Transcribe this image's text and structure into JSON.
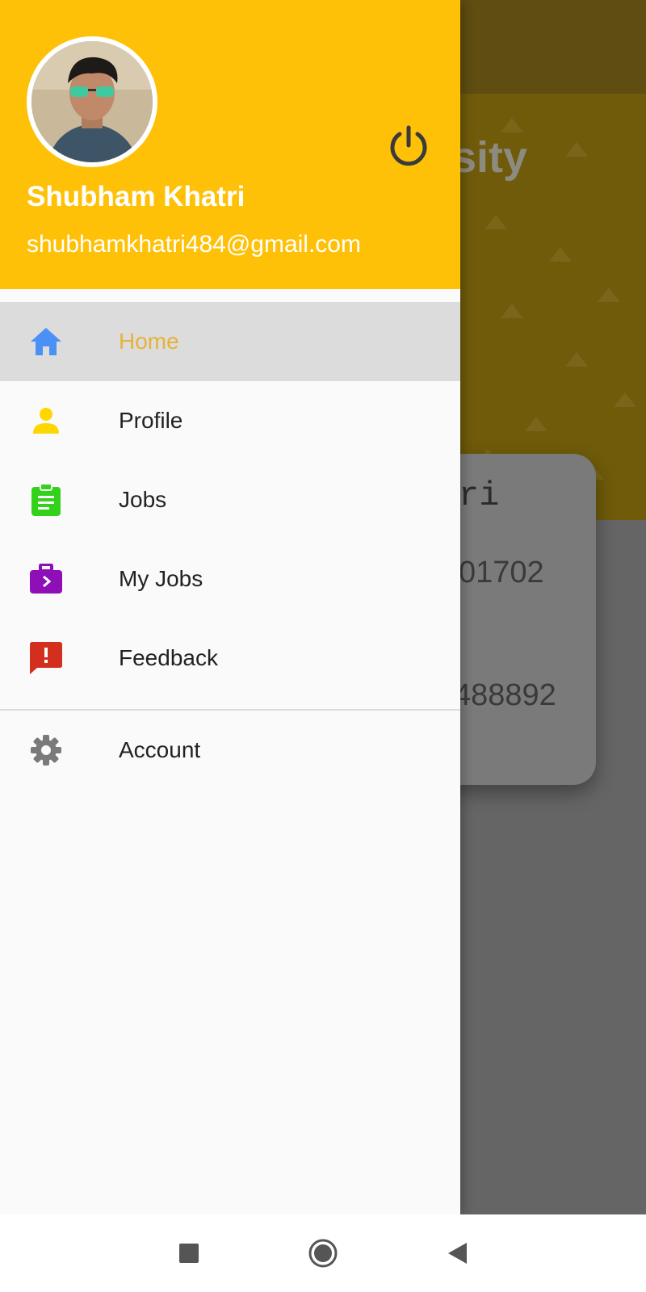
{
  "background": {
    "banner_title_fragment": "sity",
    "card": {
      "name_fragment": "ri",
      "line1_fragment": "01702",
      "line2_fragment": "488892"
    }
  },
  "drawer": {
    "header": {
      "name": "Shubham Khatri",
      "email": "shubhamkhatri484@gmail.com",
      "color": "#ffc107"
    },
    "menu_items": [
      {
        "label": "Home",
        "icon": "home-icon",
        "icon_color": "#4a90f5",
        "active": true
      },
      {
        "label": "Profile",
        "icon": "person-icon",
        "icon_color": "#ffd600"
      },
      {
        "label": "Jobs",
        "icon": "clipboard-icon",
        "icon_color": "#33d11a"
      },
      {
        "label": "My Jobs",
        "icon": "briefcase-icon",
        "icon_color": "#8e0fb8"
      },
      {
        "label": "Feedback",
        "icon": "feedback-icon",
        "icon_color": "#d32f1e"
      }
    ],
    "secondary_items": [
      {
        "label": "Account",
        "icon": "gear-icon",
        "icon_color": "#7a7a7a"
      }
    ]
  },
  "navbar": {
    "buttons": [
      "recents-button",
      "home-button",
      "back-button"
    ]
  }
}
